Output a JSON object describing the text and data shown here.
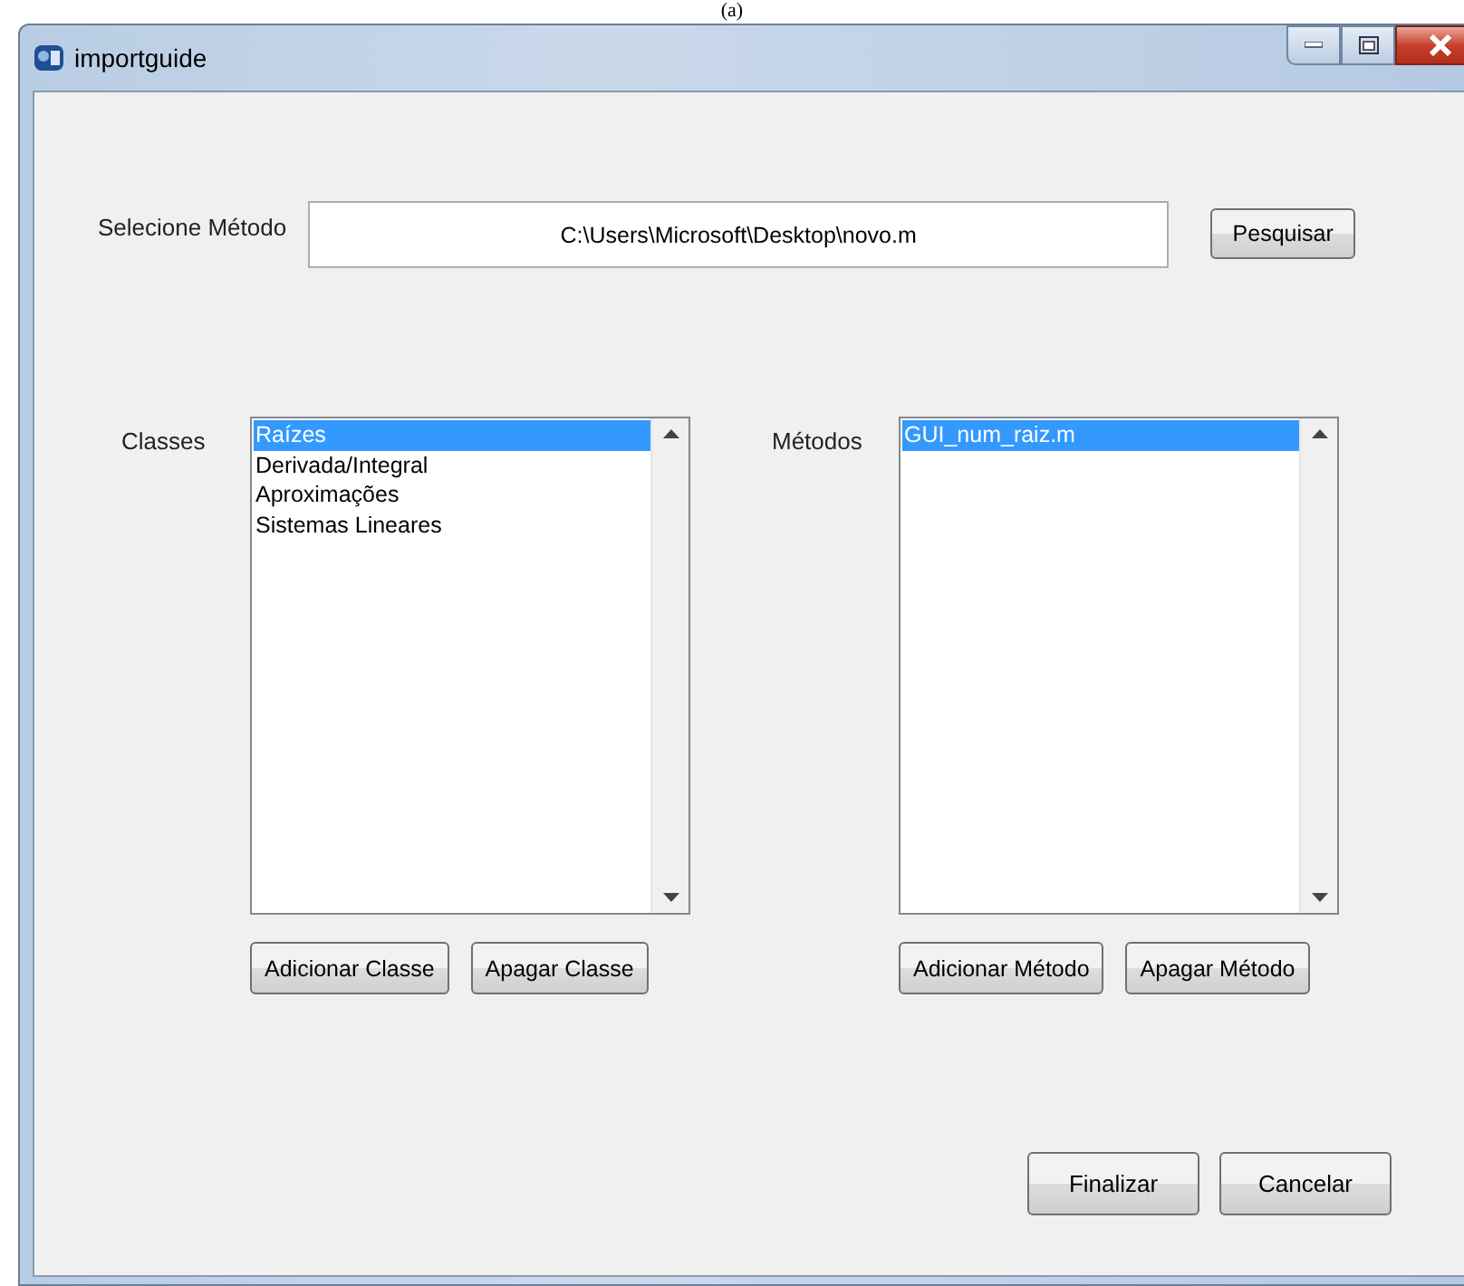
{
  "caption": "(a)",
  "window": {
    "title": "importguide"
  },
  "method_field": {
    "label": "Selecione Método",
    "value": "C:\\Users\\Microsoft\\Desktop\\novo.m"
  },
  "search_button": "Pesquisar",
  "lists": [
    {
      "label": "Classes",
      "items": [
        {
          "text": "Raízes",
          "selected": true
        },
        {
          "text": "Derivada/Integral",
          "selected": false
        },
        {
          "text": "Aproximações",
          "selected": false
        },
        {
          "text": "Sistemas Lineares",
          "selected": false
        }
      ],
      "buttons": [
        "Adicionar Classe",
        "Apagar Classe"
      ]
    },
    {
      "label": "Métodos",
      "items": [
        {
          "text": "GUI_num_raiz.m",
          "selected": true
        }
      ],
      "buttons": [
        "Adicionar Método",
        "Apagar Método"
      ]
    }
  ],
  "footer_buttons": [
    "Finalizar",
    "Cancelar"
  ]
}
